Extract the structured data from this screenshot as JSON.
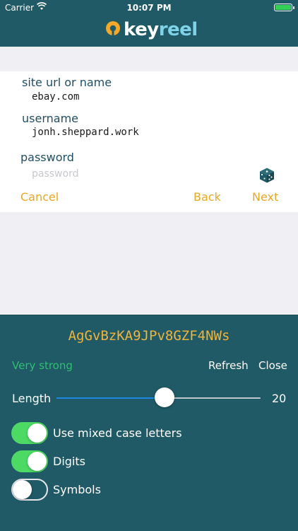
{
  "status_bar": {
    "carrier": "Carrier",
    "time": "10:07 PM"
  },
  "header": {
    "logo_text_a": "key",
    "logo_text_b": "reel"
  },
  "form": {
    "site_label": "site url or name",
    "site_value": "ebay.com",
    "username_label": "username",
    "username_value": "jonh.sheppard.work",
    "password_label": "password",
    "password_placeholder": "password",
    "cancel_label": "Cancel",
    "back_label": "Back",
    "next_label": "Next"
  },
  "generator": {
    "generated_password": "AgGvBzKA9JPv8GZF4NWs",
    "strength": "Very strong",
    "refresh_label": "Refresh",
    "close_label": "Close",
    "length_label": "Length",
    "length_value": "20",
    "length_fraction": 0.53,
    "options": [
      {
        "label": "Use mixed case letters",
        "enabled": true
      },
      {
        "label": "Digits",
        "enabled": true
      },
      {
        "label": "Symbols",
        "enabled": false
      }
    ]
  },
  "colors": {
    "header_bg": "#1f5a66",
    "accent_orange": "#e9a724",
    "password_gold": "#f0b43c",
    "strength_green": "#2fbf71",
    "toggle_on": "#4cd964"
  }
}
